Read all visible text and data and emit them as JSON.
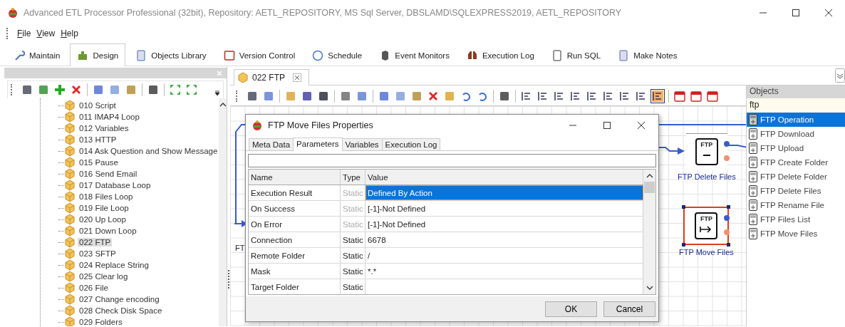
{
  "window": {
    "title": "Advanced ETL Processor Professional (32bit), Repository: AETL_REPOSITORY, MS Sql Server, DBSLAMD\\SQLEXPRESS2019, AETL_REPOSITORY"
  },
  "menu": [
    "File",
    "View",
    "Help"
  ],
  "tabs": [
    {
      "label": "Maintain",
      "kind": "wrench",
      "selected": false
    },
    {
      "label": "Design",
      "kind": "puzzle",
      "selected": true
    },
    {
      "label": "Objects Library",
      "kind": "book",
      "selected": false
    },
    {
      "label": "Version Control",
      "kind": "calendar",
      "selected": false
    },
    {
      "label": "Schedule",
      "kind": "clock",
      "selected": false
    },
    {
      "label": "Event Monitors",
      "kind": "monitor",
      "selected": false
    },
    {
      "label": "Execution Log",
      "kind": "binoculars",
      "selected": false
    },
    {
      "label": "Run SQL",
      "kind": "sql",
      "selected": false
    },
    {
      "label": "Make Notes",
      "kind": "notes",
      "selected": false
    }
  ],
  "tree": {
    "items": [
      {
        "label": "010 Script",
        "selected": false
      },
      {
        "label": "011 IMAP4 Loop",
        "selected": false
      },
      {
        "label": "012 Variables",
        "selected": false
      },
      {
        "label": "013 HTTP",
        "selected": false
      },
      {
        "label": "014 Ask Question and Show Message",
        "selected": false
      },
      {
        "label": "015 Pause",
        "selected": false
      },
      {
        "label": "016 Send Email",
        "selected": false
      },
      {
        "label": "017 Database Loop",
        "selected": false
      },
      {
        "label": "018 Files Loop",
        "selected": false
      },
      {
        "label": "019 File Loop",
        "selected": false
      },
      {
        "label": "020 Up Loop",
        "selected": false
      },
      {
        "label": "021 Down Loop",
        "selected": false
      },
      {
        "label": "022 FTP",
        "selected": true
      },
      {
        "label": "023 SFTP",
        "selected": false
      },
      {
        "label": "024 Replace String",
        "selected": false
      },
      {
        "label": "025 Clear log",
        "selected": false
      },
      {
        "label": "026 File",
        "selected": false
      },
      {
        "label": "027 Change encoding",
        "selected": false
      },
      {
        "label": "028 Check Disk Space",
        "selected": false
      },
      {
        "label": "029 Folders",
        "selected": false
      }
    ]
  },
  "document_tab": {
    "label": "022 FTP"
  },
  "canvas": {
    "partial_label": "FT",
    "nodes": [
      {
        "label": "FTP Delete Files",
        "icon_text": "FTP",
        "kind": "delete",
        "selected": false
      },
      {
        "label": "FTP Move Files",
        "icon_text": "FTP",
        "kind": "move",
        "selected": true
      }
    ]
  },
  "objects_panel": {
    "title": "Objects",
    "search": "ftp",
    "items": [
      {
        "label": "FTP Operation",
        "selected": true
      },
      {
        "label": "FTP Download",
        "selected": false
      },
      {
        "label": "FTP Upload",
        "selected": false
      },
      {
        "label": "FTP Create Folder",
        "selected": false
      },
      {
        "label": "FTP Delete Folder",
        "selected": false
      },
      {
        "label": "FTP Delete Files",
        "selected": false
      },
      {
        "label": "FTP Rename File",
        "selected": false
      },
      {
        "label": "FTP Files List",
        "selected": false
      },
      {
        "label": "FTP Move Files",
        "selected": false
      }
    ]
  },
  "dialog": {
    "title": "FTP Move Files Properties",
    "tabs": [
      {
        "label": "Meta Data",
        "selected": false
      },
      {
        "label": "Parameters",
        "selected": true
      },
      {
        "label": "Variables",
        "selected": false
      },
      {
        "label": "Execution Log",
        "selected": false
      }
    ],
    "columns": [
      "Name",
      "Type",
      "Value"
    ],
    "rows": [
      {
        "name": "Execution Result",
        "type": "Static",
        "value": "Defined By Action",
        "type_disabled": true,
        "selected": true
      },
      {
        "name": "On Success",
        "type": "Static",
        "value": "[-1]-Not Defined",
        "type_disabled": true,
        "selected": false
      },
      {
        "name": "On Error",
        "type": "Static",
        "value": "[-1]-Not Defined",
        "type_disabled": true,
        "selected": false
      },
      {
        "name": "Connection",
        "type": "Static",
        "value": "6678",
        "type_disabled": false,
        "selected": false
      },
      {
        "name": "Remote Folder",
        "type": "Static",
        "value": "/",
        "type_disabled": false,
        "selected": false
      },
      {
        "name": "Mask",
        "type": "Static",
        "value": "*.*",
        "type_disabled": false,
        "selected": false
      },
      {
        "name": "Target Folder",
        "type": "Static",
        "value": "",
        "type_disabled": false,
        "selected": false
      }
    ],
    "buttons": [
      "OK",
      "Cancel"
    ]
  }
}
